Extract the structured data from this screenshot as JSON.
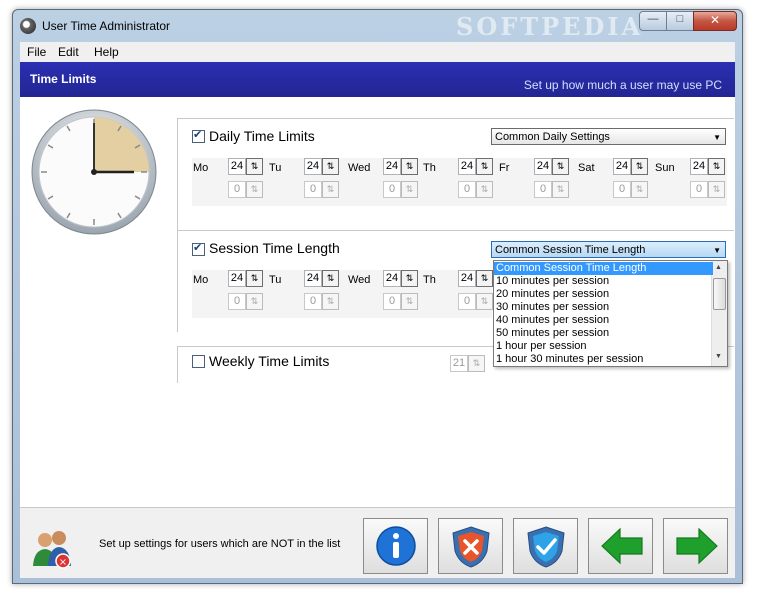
{
  "window": {
    "title": "User Time Administrator",
    "watermark": "SOFTPEDIA"
  },
  "titlebar_buttons": {
    "minimize": "—",
    "maximize": "□",
    "close": "✕"
  },
  "menu": [
    "File",
    "Edit",
    "Help"
  ],
  "header": {
    "title": "Time Limits",
    "subtitle": "Set up how much a user may use PC"
  },
  "daily": {
    "label": "Daily Time Limits",
    "checked": true,
    "combo": "Common Daily Settings",
    "days": [
      "Mo",
      "Tu",
      "Wed",
      "Th",
      "Fr",
      "Sat",
      "Sun"
    ],
    "hours": [
      "24",
      "24",
      "24",
      "24",
      "24",
      "24",
      "24"
    ],
    "minutes": [
      "0",
      "0",
      "0",
      "0",
      "0",
      "0",
      "0"
    ]
  },
  "session": {
    "label": "Session Time Length",
    "checked": true,
    "combo": "Common Session Time Length",
    "days": [
      "Mo",
      "Tu",
      "Wed",
      "Th"
    ],
    "hours": [
      "24",
      "24",
      "24",
      "24"
    ],
    "minutes": [
      "0",
      "0",
      "0",
      "0"
    ],
    "options": [
      "Common Session Time Length",
      "10 minutes per session",
      "20 minutes per session",
      "30 minutes per session",
      "40 minutes per session",
      "50 minutes per session",
      "1 hour per session",
      "1 hour 30 minutes per session"
    ]
  },
  "weekly": {
    "label": "Weekly Time Limits",
    "checked": false,
    "value": "21"
  },
  "footer": {
    "text": "Set up settings for users which are NOT in the list"
  },
  "icons": {
    "app": "clock-app-icon",
    "spin": "up-down-arrows-icon",
    "info": "info-icon",
    "reject": "shield-cross-icon",
    "accept": "shield-check-icon",
    "back": "arrow-left-icon",
    "next": "arrow-right-icon"
  },
  "colors": {
    "header": "#2b2fb3",
    "selection": "#3399ff",
    "info": "#1f73d6",
    "back": "#1fa02c"
  }
}
